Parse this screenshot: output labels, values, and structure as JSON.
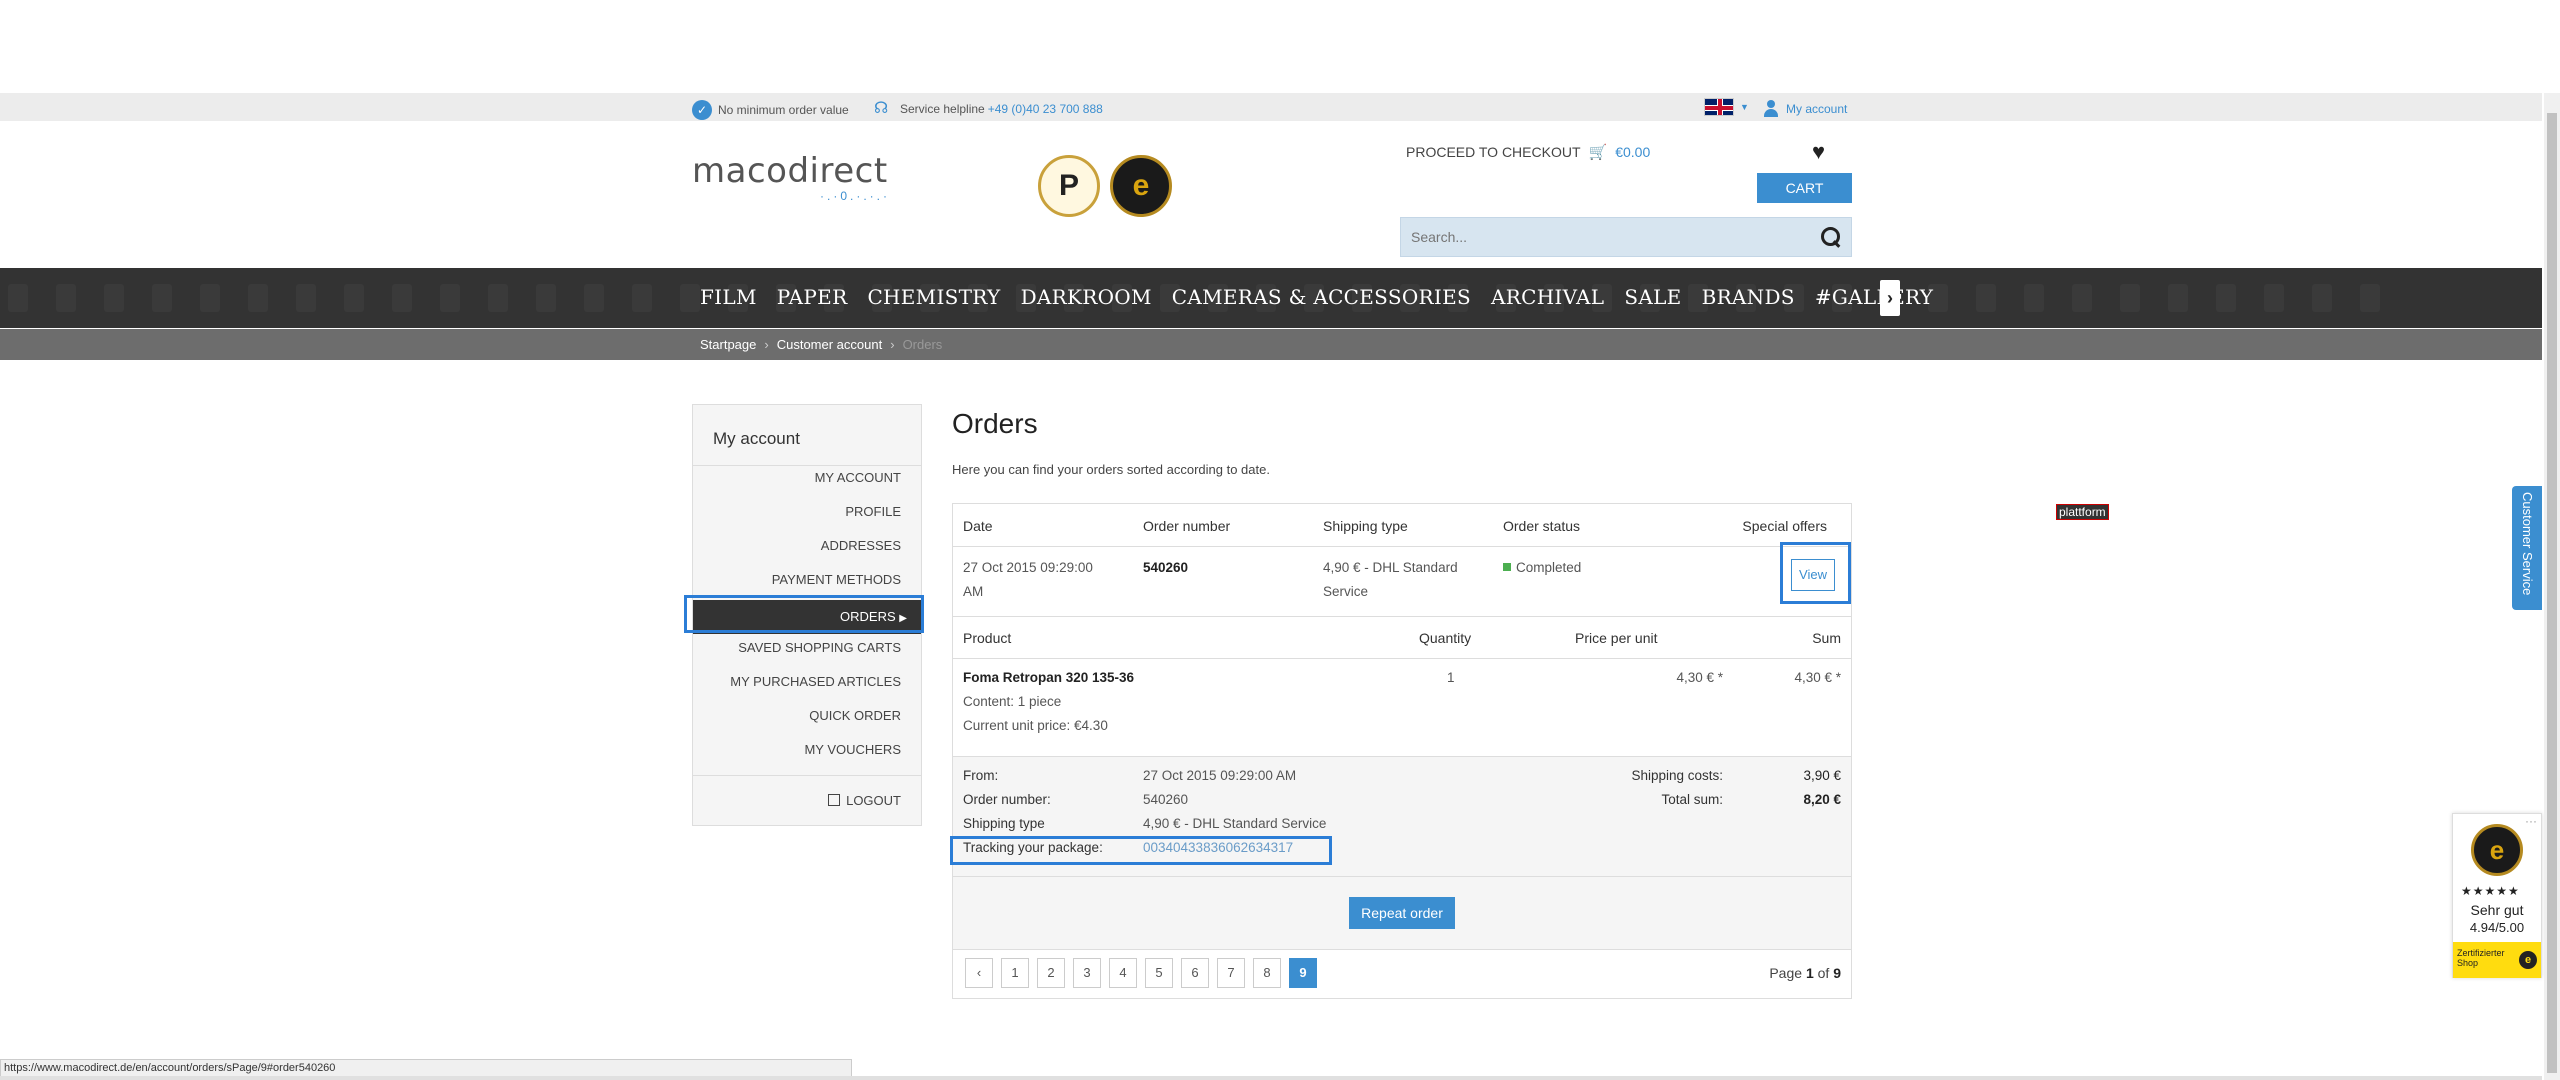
{
  "topbar": {
    "no_minimum": "No minimum order value",
    "helpline_label": "Service helpline",
    "helpline_number": "+49 (0)40 23 700 888",
    "my_account": "My account"
  },
  "header": {
    "logo": "macodirect",
    "checkout_label": "PROCEED TO CHECKOUT",
    "cart_total": "€0.00",
    "cart_button": "CART",
    "search_placeholder": "Search..."
  },
  "nav": {
    "items": [
      "FILM",
      "PAPER",
      "CHEMISTRY",
      "DARKROOM",
      "CAMERAS & ACCESSORIES",
      "ARCHIVAL",
      "SALE",
      "BRANDS",
      "#GALLERY"
    ]
  },
  "breadcrumb": [
    "Startpage",
    "Customer account",
    "Orders"
  ],
  "sidebar": {
    "title": "My account",
    "items": [
      "MY ACCOUNT",
      "PROFILE",
      "ADDRESSES",
      "PAYMENT METHODS",
      "ORDERS",
      "SAVED SHOPPING CARTS",
      "MY PURCHASED ARTICLES",
      "QUICK ORDER",
      "MY VOUCHERS"
    ],
    "logout": "LOGOUT"
  },
  "main": {
    "title": "Orders",
    "subtitle": "Here you can find your orders sorted according to date.",
    "table_headers": {
      "date": "Date",
      "order_number": "Order number",
      "shipping_type": "Shipping type",
      "order_status": "Order status",
      "special_offers": "Special offers"
    },
    "order": {
      "date_line1": "27 Oct 2015 09:29:00",
      "date_line2": "AM",
      "number": "540260",
      "shipping_line1": "4,90 € - DHL Standard",
      "shipping_line2": "Service",
      "status": "Completed",
      "view_button": "View"
    },
    "product_headers": {
      "product": "Product",
      "quantity": "Quantity",
      "price_per_unit": "Price per unit",
      "sum": "Sum"
    },
    "product": {
      "name": "Foma Retropan 320 135-36",
      "content": "Content: 1 piece",
      "current_price": "Current unit price: €4.30",
      "quantity": "1",
      "price": "4,30 € *",
      "sum": "4,30 € *"
    },
    "details": {
      "from_label": "From:",
      "from_value": "27 Oct 2015 09:29:00 AM",
      "order_number_label": "Order number:",
      "order_number_value": "540260",
      "shipping_type_label": "Shipping type",
      "shipping_type_value": "4,90 € - DHL Standard Service",
      "tracking_label": "Tracking your package:",
      "tracking_value": "00340433836062634317",
      "shipping_costs_label": "Shipping costs:",
      "shipping_costs_value": "3,90 €",
      "total_label": "Total sum:",
      "total_value": "8,20 €"
    },
    "repeat_button": "Repeat order",
    "pagination": {
      "prev": "‹",
      "pages": [
        "1",
        "2",
        "3",
        "4",
        "5",
        "6",
        "7",
        "8",
        "9"
      ],
      "active_page": "9",
      "page_label": "Page",
      "page_current": "1",
      "page_of": "of",
      "page_total": "9"
    }
  },
  "side": {
    "plattform": "plattform",
    "customer_service": "Customer Service",
    "trusted_grade": "Sehr gut",
    "trusted_score": "4.94/5.00",
    "trusted_certified": "Zertifizierter Shop",
    "trusted_stars": "★★★★★"
  },
  "status_url": "https://www.macodirect.de/en/account/orders/sPage/9#order540260"
}
